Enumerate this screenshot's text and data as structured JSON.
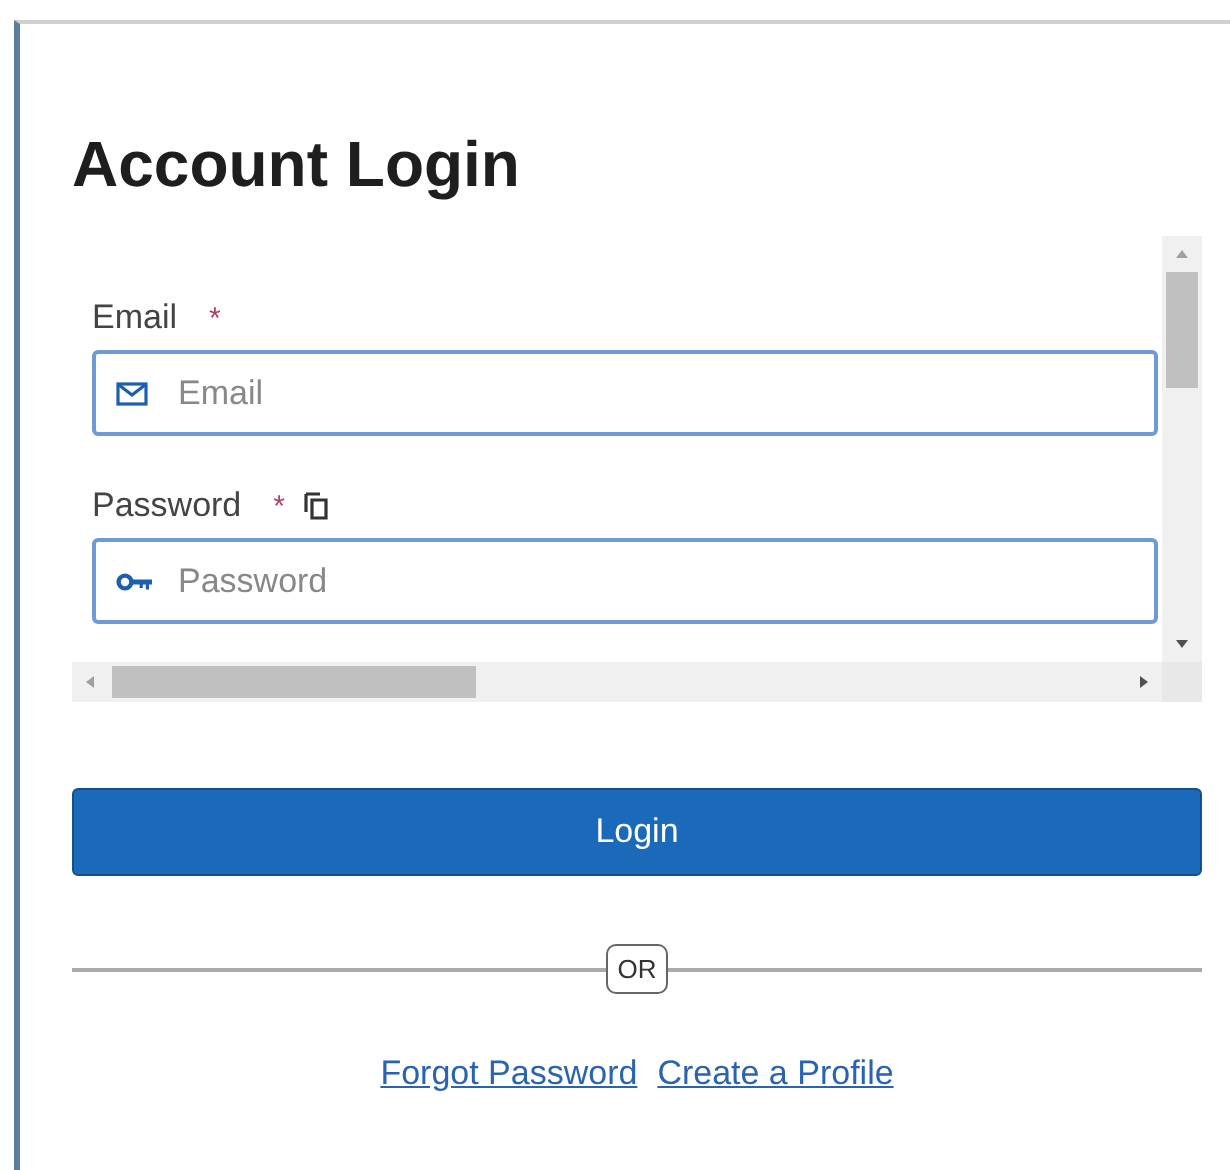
{
  "title": "Account Login",
  "fields": [
    {
      "kind": "email",
      "label": "Email",
      "required": true,
      "copy": false,
      "placeholder": "Email"
    },
    {
      "kind": "password",
      "label": "Password",
      "required": true,
      "copy": true,
      "placeholder": "Password"
    }
  ],
  "required_mark": "*",
  "login_button": "Login",
  "divider_text": "OR",
  "links": [
    "Forgot Password",
    "Create a Profile"
  ]
}
